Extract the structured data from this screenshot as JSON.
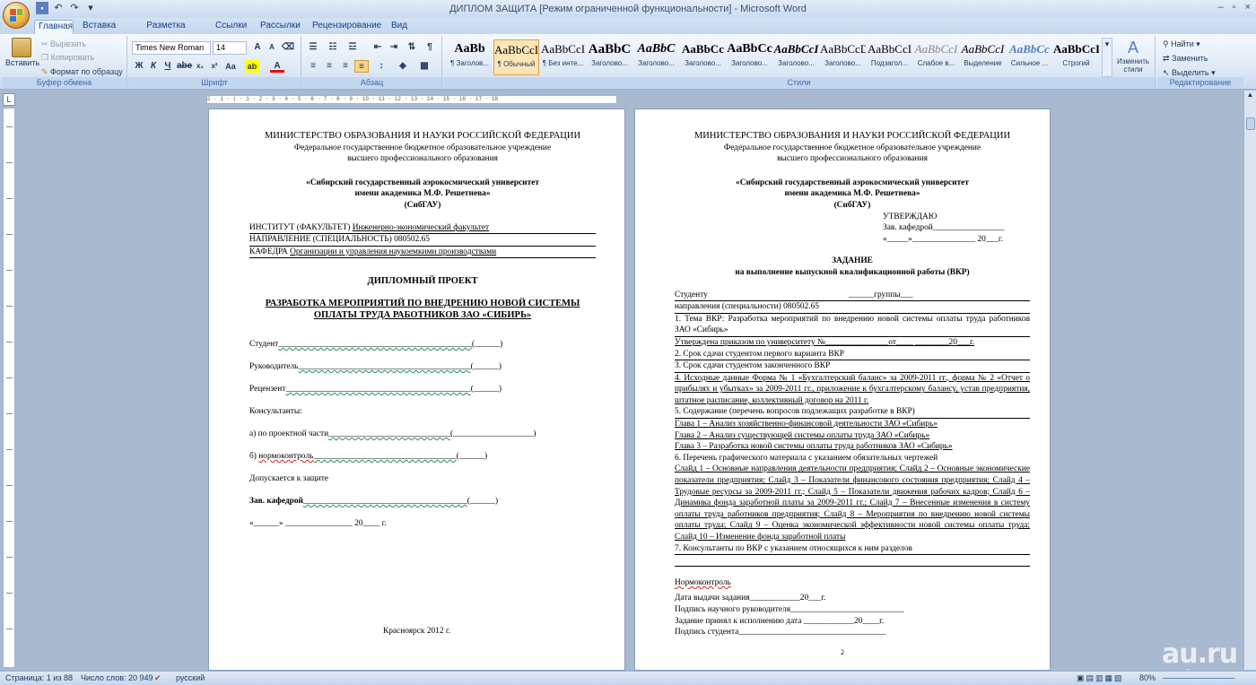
{
  "window": {
    "title": "ДИПЛОМ ЗАЩИТА [Режим ограниченной функциональности] - Microsoft Word",
    "controls": [
      "–",
      "▫",
      "×"
    ]
  },
  "ribbon": {
    "tabs": [
      "Главная",
      "Вставка",
      "Разметка страницы",
      "Ссылки",
      "Рассылки",
      "Рецензирование",
      "Вид"
    ],
    "clipboard": {
      "paste": "Вставить",
      "cut": "Вырезать",
      "copy": "Копировать",
      "format_painter": "Формат по образцу",
      "label": "Буфер обмена"
    },
    "font": {
      "name": "Times New Roman",
      "size": "14",
      "label": "Шрифт"
    },
    "paragraph": {
      "label": "Абзац"
    },
    "styles": {
      "label": "Стили",
      "items": [
        {
          "preview": "AaBb",
          "name": "¶ Заголов..."
        },
        {
          "preview": "AaBbCcI",
          "name": "¶ Обычный"
        },
        {
          "preview": "AaBbCcI",
          "name": "¶ Без инте..."
        },
        {
          "preview": "AaBbC",
          "name": "Заголово..."
        },
        {
          "preview": "AaBbC",
          "name": "Заголово..."
        },
        {
          "preview": "AaBbCc",
          "name": "Заголово..."
        },
        {
          "preview": "AaBbCc",
          "name": "Заголово..."
        },
        {
          "preview": "AaBbCcI",
          "name": "Заголово..."
        },
        {
          "preview": "AaBbCcD",
          "name": "Заголово..."
        },
        {
          "preview": "AaBbCcI",
          "name": "Подзагол..."
        },
        {
          "preview": "AaBbCcI",
          "name": "Слабое в..."
        },
        {
          "preview": "AaBbCcI",
          "name": "Выделение"
        },
        {
          "preview": "AaBbCc",
          "name": "Сильное ..."
        },
        {
          "preview": "AaBbCcI",
          "name": "Строгий"
        }
      ],
      "change_styles": "Изменить стили"
    },
    "editing": {
      "label": "Редактирование",
      "find": "Найти",
      "replace": "Заменить",
      "select": "Выделить"
    }
  },
  "ruler": {
    "marks": "2 · 1 · | · 1 · 2 · 3 · 4 · 5 · 6 · 7 · 8 · 9 · 10 · 11 · 12 · 13 · 14 · 15 · 16 · 17 · 18"
  },
  "page1": {
    "ministry": "МИНИСТЕРСТВО ОБРАЗОВАНИЯ И НАУКИ РОССИЙСКОЙ ФЕДЕРАЦИИ",
    "inst1": "Федеральное государственное бюджетное образовательное учреждение",
    "inst2": "высшего профессионального образования",
    "uni1": "«Сибирский государственный аэрокосмический университет",
    "uni2": "имени академика М.Ф. Решетнева»",
    "uni3": "(СибГАУ)",
    "institute_label": "ИНСТИТУТ (ФАКУЛЬТЕТ)",
    "institute_value": "Инженерно-экономический факультет",
    "direction_label": "НАПРАВЛЕНИЕ (СПЕЦИАЛЬНОСТЬ)",
    "direction_value": "080502.65",
    "dept_label": "КАФЕДРА",
    "dept_value": "Организации и управления наукоемкими производствами",
    "project_title": "ДИПЛОМНЫЙ ПРОЕКТ",
    "topic1": "РАЗРАБОТКА МЕРОПРИЯТИЙ ПО ВНЕДРЕНИЮ НОВОЙ СИСТЕМЫ",
    "topic2": "ОПЛАТЫ ТРУДА РАБОТНИКОВ ЗАО «СИБИРЬ»",
    "student": "Студент",
    "supervisor": "Руководитель",
    "reviewer": "Рецензент",
    "consultants": "Консультанты:",
    "consult_a": "а) по проектной части",
    "consult_b_prefix": "б)",
    "consult_b": "нормоконтроль",
    "admitted": "Допускается к защите",
    "head": "Зав. кафедрой",
    "sign_paren": "(______)",
    "sign_paren_long": "(___________________)",
    "date_line": "«______» ________________ 20____ г.",
    "city": "Красноярск 2012 г."
  },
  "page2": {
    "ministry": "МИНИСТЕРСТВО ОБРАЗОВАНИЯ И НАУКИ РОССИЙСКОЙ ФЕДЕРАЦИИ",
    "inst1": "Федеральное государственное бюджетное образовательное учреждение",
    "inst2": "высшего профессионального образования",
    "uni1": "«Сибирский государственный аэрокосмический университет",
    "uni2": "имени академика М.Ф. Решетнева»",
    "uni3": "(СибГАУ)",
    "approve": "УТВЕРЖДАЮ",
    "approve_head": "Зав. кафедрой_________________",
    "approve_date": "«_____»_______________ 20___г.",
    "task_title": "ЗАДАНИЕ",
    "task_subtitle": "на выполнение выпускной квалификационной работы (ВКР)",
    "student_line": "Студенту",
    "group": "______группы___",
    "direction": "направления (специальности) 080502.65",
    "item1": "1. Тема ВКР: Разработка мероприятий по внедрению новой системы оплаты труда работников ЗАО «Сибирь»",
    "approved": "Утверждена приказом по университету №_______________от____ ________20___г.",
    "item2": "2. Срок сдачи студентом первого варианта ВКР",
    "item3": "3. Срок сдачи студентом законченного ВКР",
    "item4": "4. Исходные данные Форма № 1 «Бухгалтерский баланс» за 2009-2011 гг., форма № 2 «Отчет о прибылях и убытках» за 2009-2011 гг., приложение к бухгалтерскому балансу, устав предприятия, штатное расписание, коллективный договор на 2011 г.",
    "item5": "5. Содержание (перечень вопросов подлежащих разработке в ВКР)",
    "ch1": "Глава 1 – Анализ хозяйственно-финансовой деятельности ЗАО «Сибирь»",
    "ch2": "Глава 2 – Анализ существующей системы оплаты труда ЗАО «Сибирь»",
    "ch3": "Глава 3 – Разработка новой системы оплаты труда работников ЗАО «Сибирь»",
    "item6": "6. Перечень графического материала с указанием обязательных чертежей",
    "slides": "Слайд 1 – Основные направления деятельности предприятия; Слайд 2 – Основные экономические показатели предприятия; Слайд 3 – Показатели финансового состояния предприятия; Слайд 4 – Трудовые ресурсы за 2009-2011 гг.; Слайд 5 – Показатели движения рабочих кадров; Слайд 6 –Динамика фонда заработной платы за 2009-2011 гг.; Слайд 7 – Внесенные изменения в систему оплаты труда работников предприятия; Слайд 8 – Мероприятия по внедрению новой системы оплаты труда; Слайд 9 – Оценка экономической эффективности новой системы оплаты труда; Слайд 10 – Изменение фонда заработной платы",
    "item7": "7. Консультанты по ВКР с указанием относящихся к ним разделов",
    "normcontrol": "Нормоконтроль",
    "issue_date": "Дата выдачи задания____________20___г.",
    "sup_sign": "Подпись научного руководителя___________________________",
    "accepted": "Задание принял к исполнению дата ____________20____г.",
    "student_sign": "Подпись студента___________________________________",
    "page_number": "2"
  },
  "statusbar": {
    "page": "Страница: 1 из 88",
    "words": "Число слов: 20 949",
    "language": "русский",
    "zoom": "80%"
  },
  "watermark": {
    "main": "au.ru",
    "sub": "первый аукцион"
  }
}
